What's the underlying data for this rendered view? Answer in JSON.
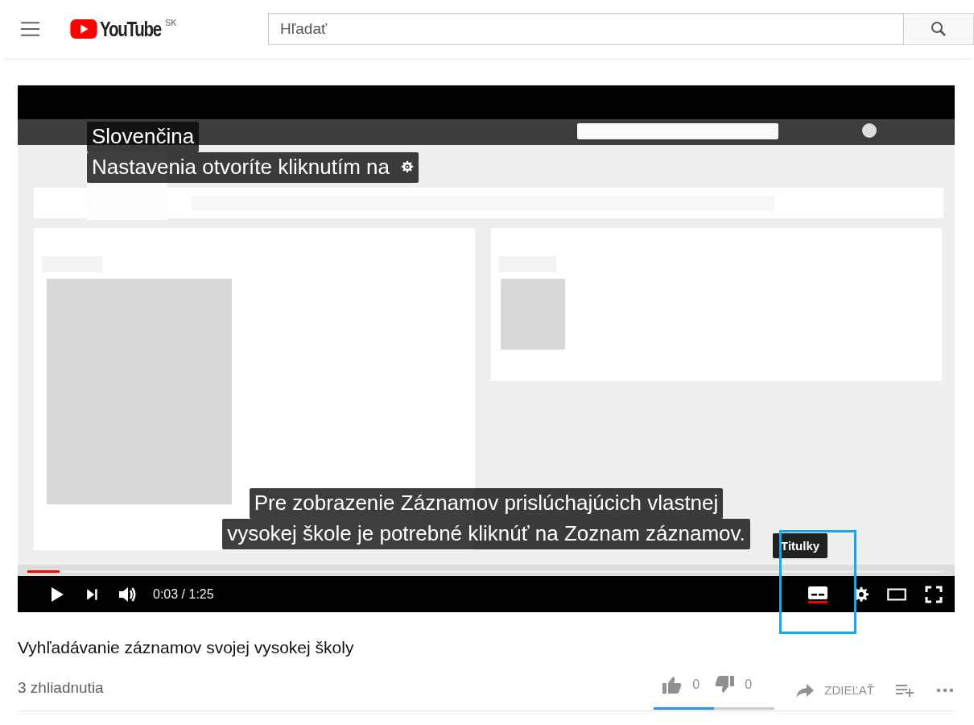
{
  "header": {
    "logo_text": "YouTube",
    "region": "SK",
    "search": {
      "placeholder": "Hľadať"
    }
  },
  "player": {
    "top_captions": [
      {
        "text": "Slovenčina",
        "kind": "text"
      },
      {
        "text": "Nastavenia otvoríte kliknutím na",
        "kind": "gear"
      }
    ],
    "bottom_captions": [
      {
        "text": "Pre zobrazenie Záznamov prislúchajúcich vlastnej"
      },
      {
        "text": "vysokej škole je potrebné kliknúť na Zoznam záznamov."
      }
    ],
    "progress": {
      "level": 0.035
    },
    "playing": false,
    "time": "0:03 / 1:25",
    "captions_on": true,
    "captions_highlighted": true,
    "tooltip": "Titulky"
  },
  "video_title": "Vyhľadávanie záznamov svojej vysokej školy",
  "views": "3 zhliadnutia",
  "likes": "0",
  "dislikes": "0",
  "share": "ZDIEĽAŤ",
  "sentiment": {
    "level": 0.5
  }
}
